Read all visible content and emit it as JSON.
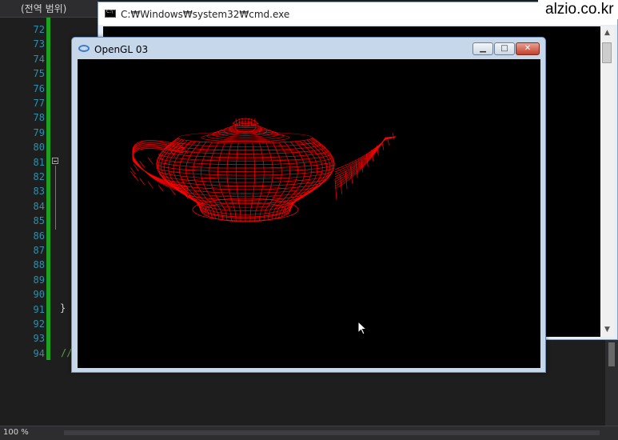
{
  "editor": {
    "scope_label": "(전역 범위)",
    "line_numbers": [
      "72",
      "73",
      "74",
      "75",
      "76",
      "77",
      "78",
      "79",
      "80",
      "81",
      "82",
      "83",
      "84",
      "85",
      "86",
      "87",
      "88",
      "89",
      "90",
      "91",
      "92",
      "93",
      "94"
    ],
    "closing_brace": "}",
    "comment_prefix": "//",
    "zoom_level": "100 %"
  },
  "cmd_window": {
    "title": "C:₩Windows₩system32₩cmd.exe"
  },
  "gl_window": {
    "title": "OpenGL 03",
    "buttons": {
      "minimize": "▁",
      "maximize": "□",
      "close": "✕"
    }
  },
  "watermark": "alzio.co.kr",
  "colors": {
    "teapot_wireframe": "#ff0000",
    "canvas_background": "#000000",
    "line_number": "#2b91af",
    "change_bar": "#1ea11e"
  }
}
